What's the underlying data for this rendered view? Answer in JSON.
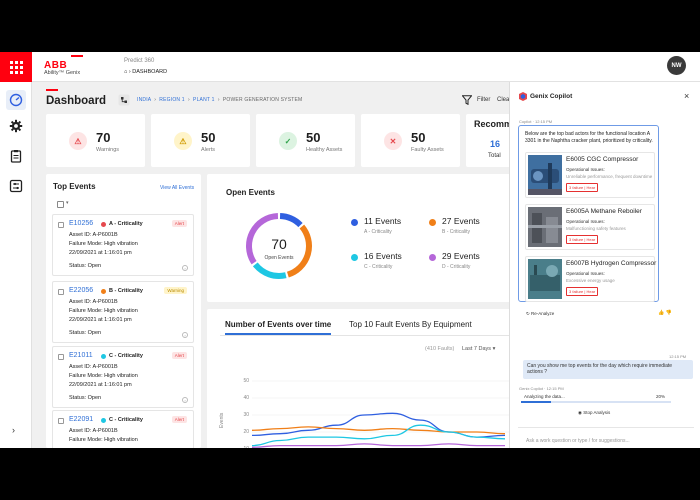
{
  "topbar": {
    "brand": "ABB",
    "product": "Ability™ Genix",
    "app_name": "Predict 360",
    "breadcrumb": "DASHBOARD",
    "avatar_initials": "NW"
  },
  "leftnav": {
    "items": [
      {
        "icon": "gauge-icon"
      },
      {
        "icon": "gear-icon"
      },
      {
        "icon": "clipboard-icon"
      },
      {
        "icon": "sliders-icon"
      }
    ],
    "expand_glyph": "›"
  },
  "header": {
    "title": "Dashboard",
    "hierarchy": [
      "INDIA",
      "REGION 1",
      "PLANT 1",
      "POWER GENERATION SYSTEM"
    ],
    "filter_label": "Filter",
    "clear_label": "Clear"
  },
  "kpis": [
    {
      "value": "70",
      "label": "Warnings",
      "icon": "warning-icon",
      "color": "#e5484d"
    },
    {
      "value": "50",
      "label": "Alerts",
      "icon": "alert-icon",
      "color": "#e8b100"
    },
    {
      "value": "50",
      "label": "Healthy Assets",
      "icon": "healthy-asset-icon",
      "color": "#2fa24a"
    },
    {
      "value": "50",
      "label": "Faulty Assets",
      "icon": "faulty-asset-icon",
      "color": "#e5484d"
    }
  ],
  "recommend": {
    "title": "Recommen",
    "value": "16",
    "label": "Total"
  },
  "top_events": {
    "title": "Top Events",
    "view_all": "View All Events",
    "events": [
      {
        "id": "E10256",
        "criticality": "A - Criticality",
        "dot": "#e5484d",
        "badge": "Alert",
        "badge_color": "#e5484d",
        "badge_bg": "#fde4e4",
        "asset": "Asset ID: A-P6001B",
        "failure": "Failure Mode: High vibration",
        "date": "22/09/2021 at 1:16:01 pm",
        "status": "Status: Open"
      },
      {
        "id": "E22056",
        "criticality": "B - Criticality",
        "dot": "#f07f18",
        "badge": "Warning",
        "badge_color": "#b88a00",
        "badge_bg": "#fff4c9",
        "asset": "Asset ID: A-P6001B",
        "failure": "Failure Mode: High vibration",
        "date": "22/09/2021 at 1:16:01 pm",
        "status": "Status: Open"
      },
      {
        "id": "E21011",
        "criticality": "C - Criticality",
        "dot": "#1ec7e3",
        "badge": "Alert",
        "badge_color": "#e5484d",
        "badge_bg": "#fde4e4",
        "asset": "Asset ID: A-P6001B",
        "failure": "Failure Mode: High vibration",
        "date": "22/09/2021 at 1:16:01 pm",
        "status": "Status: Open"
      },
      {
        "id": "E22091",
        "criticality": "C - Criticality",
        "dot": "#1ec7e3",
        "badge": "Alert",
        "badge_color": "#e5484d",
        "badge_bg": "#fde4e4",
        "asset": "Asset ID: A-P6001B",
        "failure": "Failure Mode: High vibration",
        "date": "",
        "status": ""
      }
    ]
  },
  "open_events": {
    "title": "Open Events",
    "total": "70",
    "total_label": "Open Events",
    "legend": [
      {
        "value": "11 Events",
        "label": "A - Criticality",
        "color": "#2f5fe0"
      },
      {
        "value": "27 Events",
        "label": "B - Criticality",
        "color": "#f07f18"
      },
      {
        "value": "16 Events",
        "label": "C - Criticality",
        "color": "#1ec7e3"
      },
      {
        "value": "29 Events",
        "label": "D - Criticality",
        "color": "#b567d9"
      }
    ],
    "segments": [
      {
        "value": 11,
        "color": "#2f5fe0"
      },
      {
        "value": 27,
        "color": "#f07f18"
      },
      {
        "value": 16,
        "color": "#1ec7e3"
      },
      {
        "value": 29,
        "color": "#b567d9"
      }
    ]
  },
  "events_over_time": {
    "tabs": [
      "Number of Events over time",
      "Top 10 Fault Events By Equipment"
    ],
    "faults_label": "(410 Faults)",
    "range_label": "Last 7 Days",
    "y_axis_label": "Events",
    "y_ticks": [
      "50",
      "40",
      "30",
      "20",
      "10"
    ]
  },
  "chart_data": {
    "type": "line",
    "ylabel": "Events",
    "ylim": [
      10,
      50
    ],
    "series": [
      {
        "color": "#2f5fe0",
        "values": [
          18,
          19,
          21,
          24,
          30,
          31,
          27,
          20,
          17,
          18
        ]
      },
      {
        "color": "#f07f18",
        "values": [
          21,
          22,
          23,
          22,
          21,
          22,
          21,
          20,
          20,
          19
        ]
      },
      {
        "color": "#1ec7e3",
        "values": [
          12,
          15,
          17,
          17,
          16,
          18,
          24,
          20,
          17,
          16
        ]
      },
      {
        "color": "#b567d9",
        "values": [
          11,
          12,
          12,
          12,
          13,
          12,
          12,
          13,
          12,
          12
        ]
      }
    ]
  },
  "copilot": {
    "title": "Genix Copilot",
    "msg_meta": "Copilot · 12:15 PM",
    "intro": "Below are the top bad actors for the functional location A 3301 in the Naphtha cracker plant, prioritized by criticality.",
    "assets": [
      {
        "name": "E6005 CGC Compressor",
        "issues": "Operational Issues:",
        "desc": "Unreliable performance, frequent downtime",
        "button": "3 failure | Hear",
        "img_color": "#3f6fa0"
      },
      {
        "name": "E6005A Methane Reboiler",
        "issues": "Operational Issues:",
        "desc": "Malfunctioning safety features",
        "button": "3 failure | Hear",
        "img_color": "#6a6e76"
      },
      {
        "name": "E6007B Hydrogen Compressor",
        "issues": "Operational Issues:",
        "desc": "Excessive energy usage",
        "button": "3 failure | Hear",
        "img_color": "#4a7e8a"
      }
    ],
    "reanalyze": "Re-Analyze",
    "question_time": "12:15 PM",
    "question": "Can you show me top events for the day which require immediate actions ?",
    "analyzing_meta": "Genix Copilot · 12:15 PM",
    "analyzing": "Analyzing the data...",
    "progress_pct": "20%",
    "progress": 0.2,
    "stop": "Stop Analysis",
    "input_placeholder": "Ask a work question or type / for suggestions..."
  }
}
